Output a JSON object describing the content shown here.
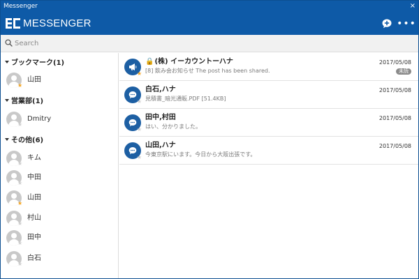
{
  "window": {
    "title": "Messenger",
    "close": "×"
  },
  "header": {
    "logo_text": "MESSENGER",
    "more": "•••"
  },
  "search": {
    "placeholder": "Search",
    "value": ""
  },
  "sidebar": {
    "groups": [
      {
        "label": "ブックマーク(1)",
        "contacts": [
          {
            "name": "山田",
            "starred": true
          }
        ]
      },
      {
        "label": "営業部(1)",
        "contacts": [
          {
            "name": "Dmitry",
            "starred": false
          }
        ]
      },
      {
        "label": "その他(6)",
        "contacts": [
          {
            "name": "キム",
            "starred": false
          },
          {
            "name": "中田",
            "starred": false
          },
          {
            "name": "山田",
            "starred": true
          },
          {
            "name": "村山",
            "starred": false
          },
          {
            "name": "田中",
            "starred": false
          },
          {
            "name": "白石",
            "starred": false
          }
        ]
      }
    ]
  },
  "threads": [
    {
      "title": "(株) イーカウントーハナ",
      "locked": true,
      "preview": "[8] 飲み会お知らせ The post has been shared.",
      "date": "2017/05/08",
      "badge": "未読",
      "icon": "megaphone-icon",
      "starred": true
    },
    {
      "title": "白石,ハナ",
      "locked": false,
      "preview": "見積書_暗光通販.PDF [51.4KB]",
      "date": "2017/05/08",
      "badge": "",
      "icon": "chat-bubble-icon",
      "starred": false
    },
    {
      "title": "田中,村田",
      "locked": false,
      "preview": "はい、分かりました。",
      "date": "2017/05/08",
      "badge": "",
      "icon": "chat-bubble-icon",
      "starred": false
    },
    {
      "title": "山田,ハナ",
      "locked": false,
      "preview": "今東京駅にいます。今日から大阪出張です。",
      "date": "2017/05/08",
      "badge": "",
      "icon": "chat-bubble-icon",
      "starred": false
    }
  ],
  "colors": {
    "brand": "#0e5aa7",
    "star": "#f5a623",
    "lock": "#d0021b"
  }
}
